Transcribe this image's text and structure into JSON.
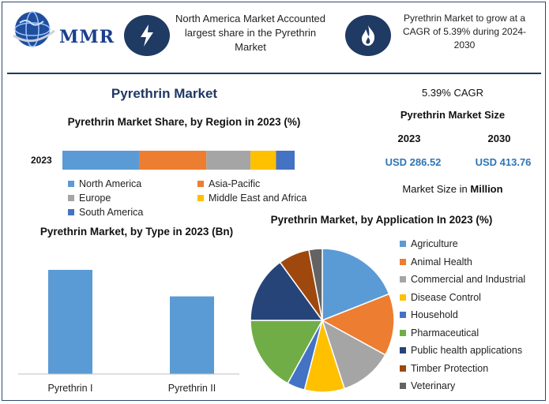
{
  "header": {
    "logo_text": "MMR",
    "info1": "North America Market Accounted largest share in the Pyrethrin Market",
    "info2": "Pyrethrin Market to grow at a CAGR of 5.39% during 2024-2030",
    "colors": {
      "icon_bg": "#1f3a63",
      "accent": "#2e75b6"
    }
  },
  "main_title": "Pyrethrin Market",
  "stats": {
    "cagr": "5.39% CAGR",
    "size_title": "Pyrethrin Market Size",
    "year1": "2023",
    "year2": "2030",
    "value1": "USD 286.52",
    "value2": "USD 413.76",
    "unit_prefix": "Market Size in",
    "unit_bold": "Million"
  },
  "chart_data": [
    {
      "type": "bar",
      "orientation": "horizontal-stacked",
      "title": "Pyrethrin Market Share, by Region in 2023 (%)",
      "categories": [
        "2023"
      ],
      "series": [
        {
          "name": "North America",
          "values": [
            33
          ],
          "color": "#5b9bd5"
        },
        {
          "name": "Asia-Pacific",
          "values": [
            29
          ],
          "color": "#ed7d31"
        },
        {
          "name": "Europe",
          "values": [
            19
          ],
          "color": "#a5a5a5"
        },
        {
          "name": "Middle East and Africa",
          "values": [
            11
          ],
          "color": "#ffc000"
        },
        {
          "name": "South America",
          "values": [
            8
          ],
          "color": "#4472c4"
        }
      ],
      "xlim": [
        0,
        100
      ],
      "legend": "bottom"
    },
    {
      "type": "bar",
      "title": "Pyrethrin Market, by Type in 2023 (Bn)",
      "categories": [
        "Pyrethrin I",
        "Pyrethrin II"
      ],
      "values": [
        55,
        41
      ],
      "color": "#5b9bd5",
      "ylim": [
        0,
        60
      ]
    },
    {
      "type": "pie",
      "title": "Pyrethrin Market, by Application In 2023 (%)",
      "legend": "right",
      "slices": [
        {
          "label": "Agriculture",
          "value": 19,
          "color": "#5b9bd5"
        },
        {
          "label": "Animal Health",
          "value": 14,
          "color": "#ed7d31"
        },
        {
          "label": "Commercial and Industrial",
          "value": 12,
          "color": "#a5a5a5"
        },
        {
          "label": "Disease Control",
          "value": 9,
          "color": "#ffc000"
        },
        {
          "label": "Household",
          "value": 4,
          "color": "#4472c4"
        },
        {
          "label": "Pharmaceutical",
          "value": 17,
          "color": "#70ad47"
        },
        {
          "label": "Public health applications",
          "value": 15,
          "color": "#264478"
        },
        {
          "label": "Timber Protection",
          "value": 7,
          "color": "#9e480e"
        },
        {
          "label": "Veterinary",
          "value": 3,
          "color": "#636363"
        }
      ]
    }
  ]
}
